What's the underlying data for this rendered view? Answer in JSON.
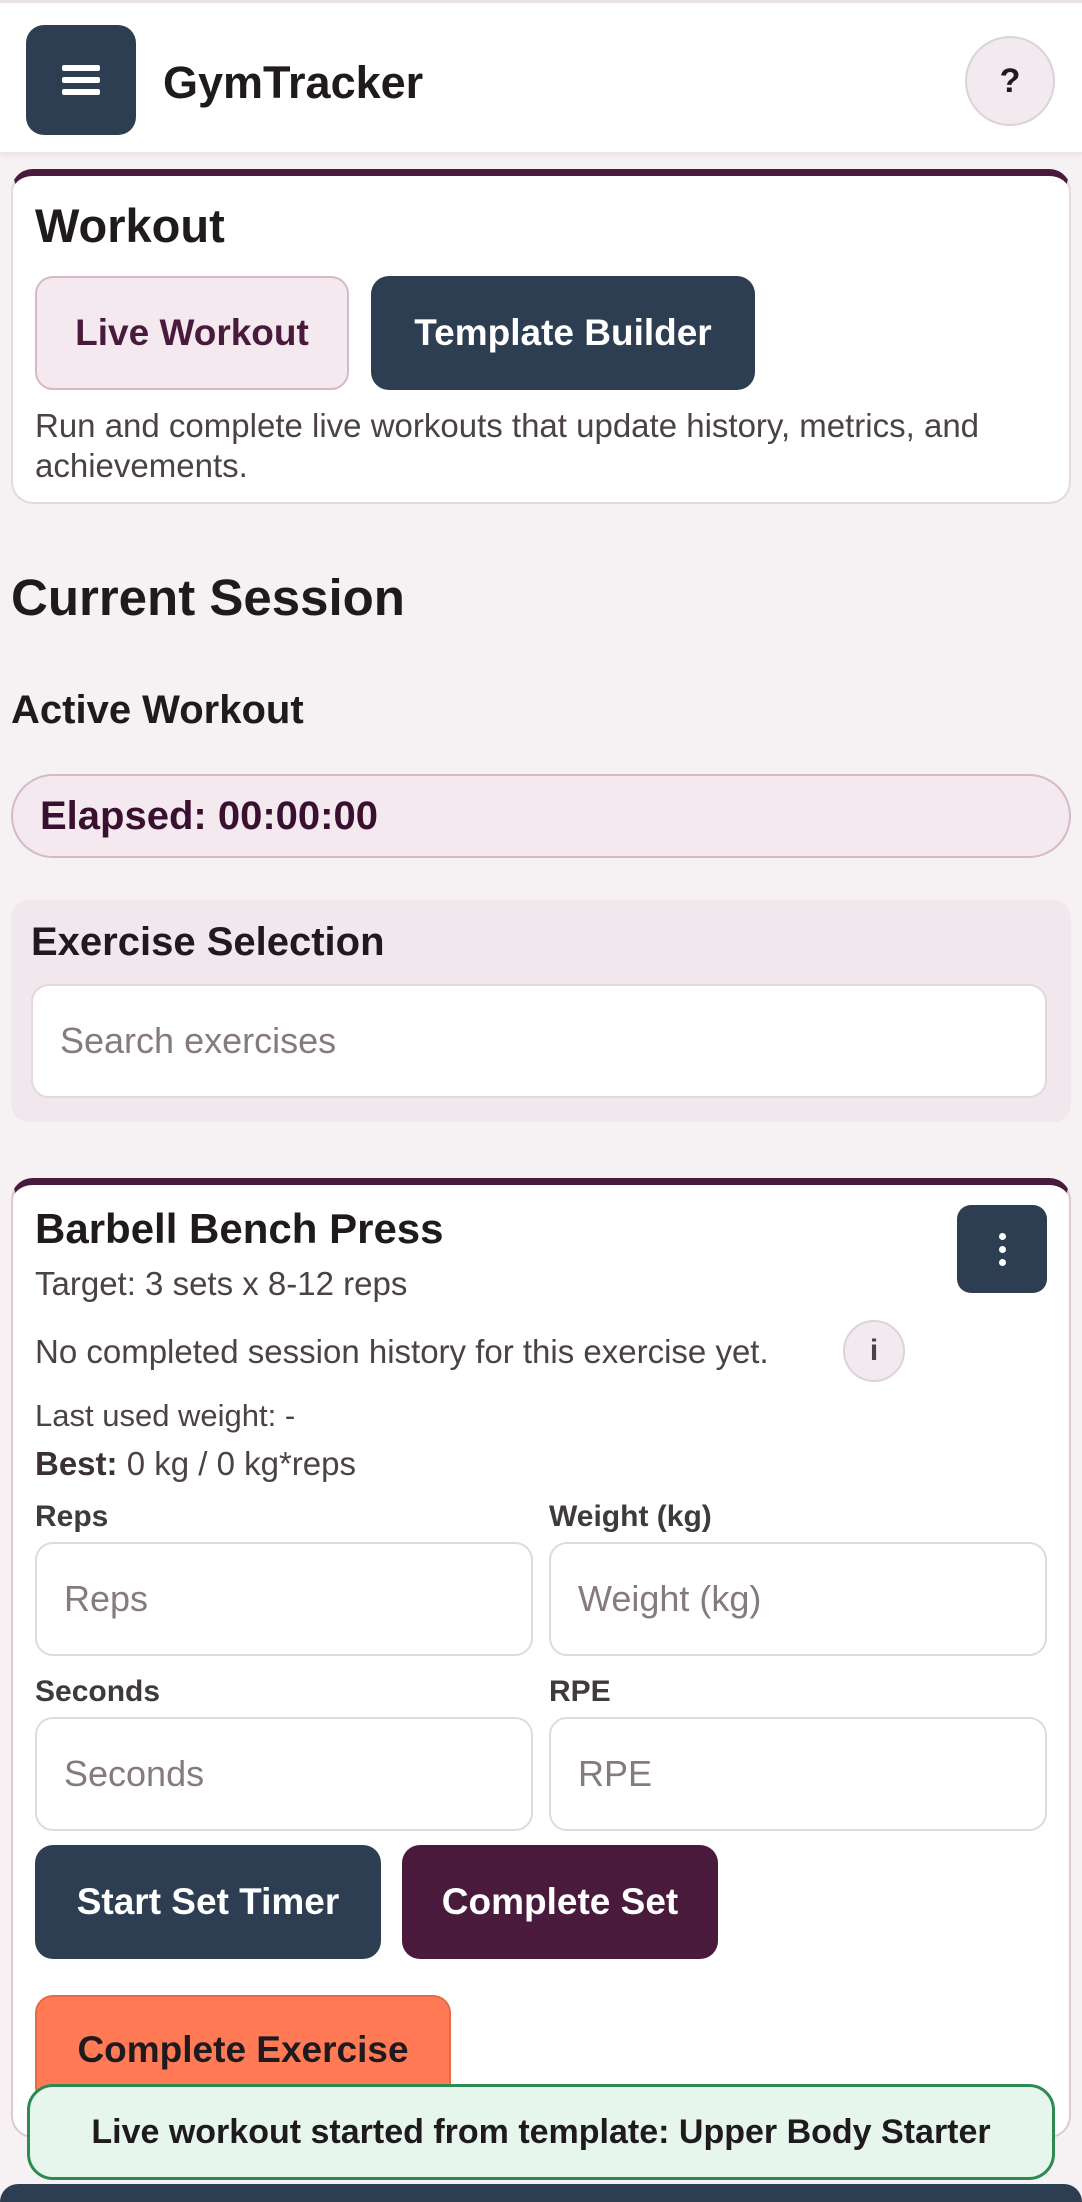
{
  "app": {
    "title": "GymTracker",
    "menu_icon": "hamburger-icon",
    "help_label": "?"
  },
  "workout": {
    "title": "Workout",
    "tabs": [
      {
        "label": "Live Workout",
        "active": true
      },
      {
        "label": "Template Builder",
        "active": false
      }
    ],
    "description": "Run and complete live workouts that update history, metrics, and achievements."
  },
  "session": {
    "title": "Current Session",
    "subtitle": "Active Workout",
    "elapsed": "Elapsed: 00:00:00"
  },
  "selection": {
    "title": "Exercise Selection",
    "search_placeholder": "Search exercises"
  },
  "exercise": {
    "name": "Barbell Bench Press",
    "target": "Target: 3 sets x 8-12 reps",
    "history": "No completed session history for this exercise yet.",
    "info_label": "i",
    "last_weight": "Last used weight: -",
    "best_label": "Best:",
    "best_value": " 0 kg / 0 kg*reps",
    "fields": {
      "reps": {
        "label": "Reps",
        "placeholder": "Reps"
      },
      "weight": {
        "label": "Weight (kg)",
        "placeholder": "Weight (kg)"
      },
      "seconds": {
        "label": "Seconds",
        "placeholder": "Seconds"
      },
      "rpe": {
        "label": "RPE",
        "placeholder": "RPE"
      }
    },
    "buttons": {
      "start_timer": "Start Set Timer",
      "complete_set": "Complete Set",
      "complete_exercise": "Complete Exercise"
    }
  },
  "toast": {
    "message": "Live workout started from template: Upper Body Starter"
  },
  "colors": {
    "primary": "#2e3e52",
    "accent": "#4a1a3c",
    "orange": "#ff7a55",
    "success": "#2d8a50"
  }
}
